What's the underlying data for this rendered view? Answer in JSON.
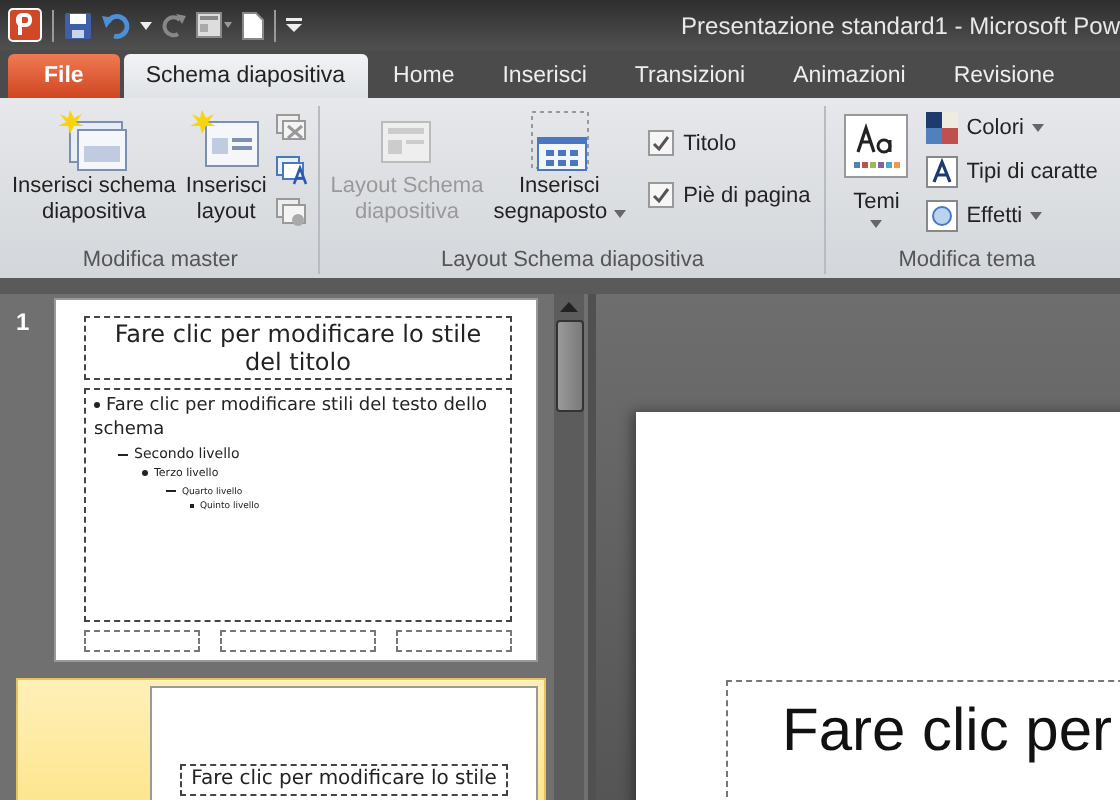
{
  "window": {
    "title": "Presentazione standard1  -  Microsoft Pow"
  },
  "tabs": [
    {
      "label": "File",
      "kind": "file",
      "selected": false
    },
    {
      "label": "Schema diapositiva",
      "kind": "tab",
      "selected": true
    },
    {
      "label": "Home",
      "kind": "tab",
      "selected": false
    },
    {
      "label": "Inserisci",
      "kind": "tab",
      "selected": false
    },
    {
      "label": "Transizioni",
      "kind": "tab",
      "selected": false
    },
    {
      "label": "Animazioni",
      "kind": "tab",
      "selected": false
    },
    {
      "label": "Revisione",
      "kind": "tab",
      "selected": false
    }
  ],
  "ribbon": {
    "master_group": {
      "label": "Modifica master",
      "buttons": [
        {
          "lines": [
            "Inserisci schema",
            "diapositiva"
          ],
          "kind": "master",
          "disabled": false
        },
        {
          "lines": [
            "Inserisci",
            "layout"
          ],
          "kind": "layout",
          "disabled": false
        }
      ]
    },
    "layout_group": {
      "label": "Layout Schema diapositiva",
      "buttons": [
        {
          "lines": [
            "Layout Schema",
            "diapositiva"
          ],
          "kind": "layout",
          "disabled": true,
          "dropdown": false
        },
        {
          "lines": [
            "Inserisci",
            "segnaposto"
          ],
          "kind": "placeholder",
          "disabled": false,
          "dropdown": true
        }
      ],
      "checkboxes": [
        {
          "label": "Titolo",
          "checked": true
        },
        {
          "label": "Piè di pagina",
          "checked": true
        }
      ]
    },
    "theme_group": {
      "label": "Modifica tema",
      "themes_button": {
        "label": "Temi"
      },
      "menu": [
        {
          "label": "Colori",
          "kind": "colors",
          "dropdown": true
        },
        {
          "label": "Tipi di caratte",
          "kind": "fonts",
          "dropdown": false
        },
        {
          "label": "Effetti",
          "kind": "effects",
          "dropdown": true
        }
      ]
    }
  },
  "thumbnails": [
    {
      "number": "1",
      "selected": false,
      "title": "Fare clic per modificare lo stile del titolo",
      "body": [
        {
          "text": "Fare clic per modificare stili del testo dello schema",
          "children": [
            {
              "text": "Secondo livello",
              "children": [
                {
                  "text": "Terzo livello",
                  "children": [
                    {
                      "text": "Quarto livello",
                      "children": [
                        {
                          "text": "Quinto livello"
                        }
                      ]
                    }
                  ]
                }
              ]
            }
          ]
        }
      ]
    },
    {
      "selected": true,
      "title": "Fare clic per modificare lo stile"
    }
  ],
  "slide": {
    "title": "Fare clic per"
  }
}
